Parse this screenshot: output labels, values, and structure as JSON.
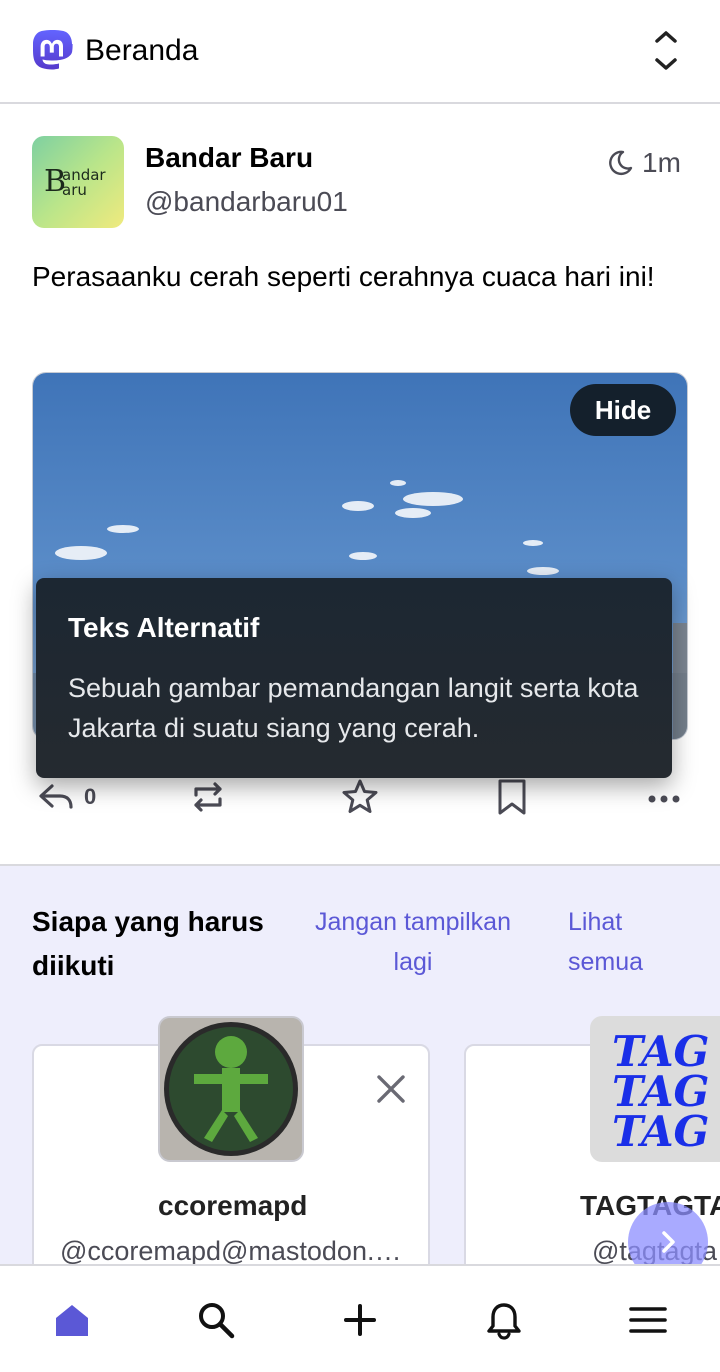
{
  "header": {
    "title": "Beranda",
    "logo_icon": "mastodon-logo-icon",
    "sort_icon": "chevron-up-down-icon"
  },
  "post": {
    "avatar_text_big": "B",
    "avatar_text_small_top": "andar",
    "avatar_text_small_bottom": "aru",
    "author_name": "Bandar Baru",
    "author_handle": "@bandarbaru01",
    "time": "1m",
    "time_icon": "moon-icon",
    "text": "Perasaanku cerah seperti cerahnya cuaca hari ini!",
    "hide_label": "Hide",
    "alt_title": "Teks Alternatif",
    "alt_description": "Sebuah gambar pemandangan langit serta kota Jakarta di suatu siang yang cerah.",
    "reply_count": "0"
  },
  "suggestions": {
    "title": "Siapa yang harus diikuti",
    "dismiss_label": "Jangan tampilkan lagi",
    "view_all_label": "Lihat semua",
    "cards": [
      {
        "name": "ccoremapd",
        "handle": "@ccoremapd@mastodon.…"
      },
      {
        "name": "TAGTAGTA",
        "handle": "@tagtagta",
        "avatar_lines": [
          "TAG",
          "TAG",
          "TAG"
        ]
      }
    ]
  },
  "nav": {
    "items": [
      "home-icon",
      "search-icon",
      "plus-icon",
      "bell-icon",
      "menu-icon"
    ],
    "accent": "#5b58d6"
  },
  "colors": {
    "accent": "#5b58d6",
    "muted": "#4b4b55",
    "suggest_bg": "#eeeefc"
  }
}
